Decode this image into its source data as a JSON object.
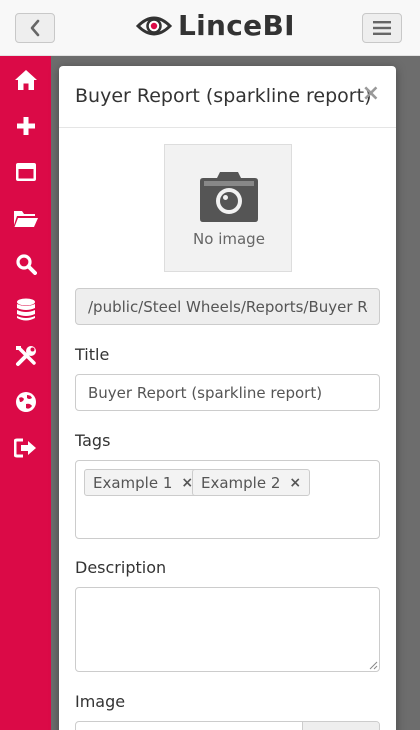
{
  "app": {
    "brand": "LinceBI"
  },
  "header_icons": {
    "back": "chevron-left-icon",
    "menu": "hamburger-icon",
    "logo": "eye-icon"
  },
  "sidebar": {
    "items": [
      {
        "id": "home",
        "icon": "home-icon"
      },
      {
        "id": "new",
        "icon": "plus-icon"
      },
      {
        "id": "window",
        "icon": "window-icon"
      },
      {
        "id": "open",
        "icon": "folder-open-icon"
      },
      {
        "id": "search",
        "icon": "search-icon"
      },
      {
        "id": "database",
        "icon": "database-icon"
      },
      {
        "id": "tools",
        "icon": "tools-icon"
      },
      {
        "id": "language",
        "icon": "globe-icon"
      },
      {
        "id": "logout",
        "icon": "sign-out-icon"
      }
    ]
  },
  "modal": {
    "title": "Buyer Report (sparkline report)",
    "close_label": "×",
    "image_placeholder": "No image",
    "path": "/public/Steel Wheels/Reports/Buyer Report (sparkline report)",
    "title_label": "Title",
    "title_value": "Buyer Report (sparkline report)",
    "tags_label": "Tags",
    "tags": [
      {
        "label": "Example 1",
        "remove": "×"
      },
      {
        "label": "Example 2",
        "remove": "×"
      }
    ],
    "description_label": "Description",
    "description_value": "",
    "image_label": "Image"
  },
  "colors": {
    "accent": "#db0a47",
    "backdrop": "#6d6d6d"
  }
}
